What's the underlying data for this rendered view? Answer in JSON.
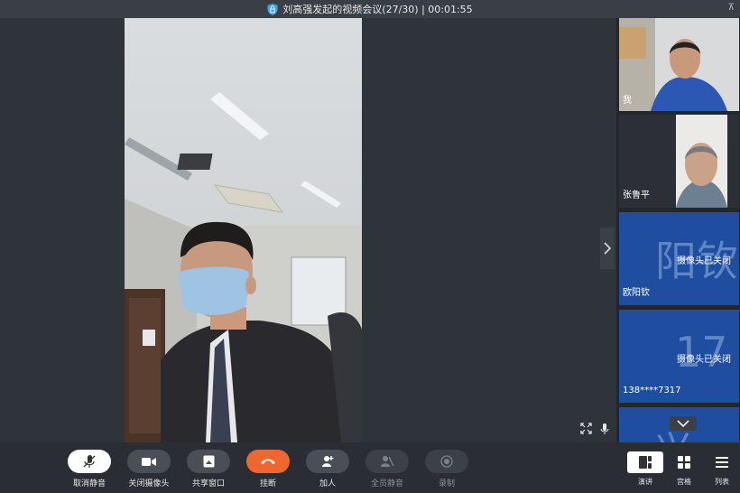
{
  "window": {
    "title": "刘高强发起的视频会议(27/30) | 00:01:55"
  },
  "participants": [
    {
      "name": "我"
    },
    {
      "name": "张鲁平"
    },
    {
      "name": "欧阳钦",
      "status": "摄像头已关闭",
      "avatar_text": "阳钦"
    },
    {
      "name": "138****7317",
      "status": "摄像头已关闭",
      "avatar_text": "17"
    },
    {
      "avatar_text": "兴"
    }
  ],
  "toolbar": {
    "unmute": "取消静音",
    "camera_off": "关闭摄像头",
    "share": "共享窗口",
    "hangup": "挂断",
    "add": "加人",
    "mute_all": "全员静音",
    "record": "录制"
  },
  "views": {
    "speaker": "演讲",
    "grid": "宫格",
    "list": "列表"
  },
  "colors": {
    "hangup": "#f0662f",
    "tile_off": "#1f4ea0",
    "background": "#2b2f35"
  }
}
